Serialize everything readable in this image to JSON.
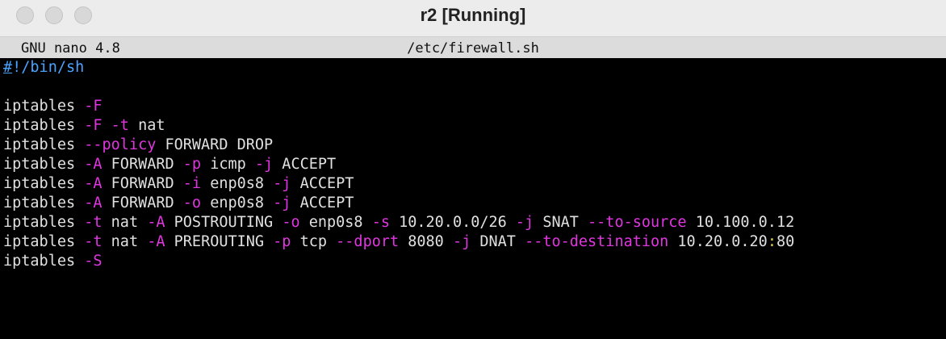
{
  "window": {
    "title": "r2 [Running]"
  },
  "nano": {
    "version": "GNU nano 4.8",
    "filename": "/etc/firewall.sh"
  },
  "file_lines": [
    [
      {
        "t": "#",
        "c": "cursor-hash"
      },
      {
        "t": "!/bin/sh",
        "c": "shebang"
      }
    ],
    [],
    [
      {
        "t": "iptables ",
        "c": "k"
      },
      {
        "t": "-F",
        "c": "o"
      }
    ],
    [
      {
        "t": "iptables ",
        "c": "k"
      },
      {
        "t": "-F",
        "c": "o"
      },
      {
        "t": " ",
        "c": "k"
      },
      {
        "t": "-t",
        "c": "o"
      },
      {
        "t": " nat",
        "c": "k"
      }
    ],
    [
      {
        "t": "iptables ",
        "c": "k"
      },
      {
        "t": "--policy",
        "c": "o"
      },
      {
        "t": " FORWARD DROP",
        "c": "k"
      }
    ],
    [
      {
        "t": "iptables ",
        "c": "k"
      },
      {
        "t": "-A",
        "c": "o"
      },
      {
        "t": " FORWARD ",
        "c": "k"
      },
      {
        "t": "-p",
        "c": "o"
      },
      {
        "t": " icmp ",
        "c": "k"
      },
      {
        "t": "-j",
        "c": "o"
      },
      {
        "t": " ACCEPT",
        "c": "k"
      }
    ],
    [
      {
        "t": "iptables ",
        "c": "k"
      },
      {
        "t": "-A",
        "c": "o"
      },
      {
        "t": " FORWARD ",
        "c": "k"
      },
      {
        "t": "-i",
        "c": "o"
      },
      {
        "t": " enp0s8 ",
        "c": "k"
      },
      {
        "t": "-j",
        "c": "o"
      },
      {
        "t": " ACCEPT",
        "c": "k"
      }
    ],
    [
      {
        "t": "iptables ",
        "c": "k"
      },
      {
        "t": "-A",
        "c": "o"
      },
      {
        "t": " FORWARD ",
        "c": "k"
      },
      {
        "t": "-o",
        "c": "o"
      },
      {
        "t": " enp0s8 ",
        "c": "k"
      },
      {
        "t": "-j",
        "c": "o"
      },
      {
        "t": " ACCEPT",
        "c": "k"
      }
    ],
    [
      {
        "t": "iptables ",
        "c": "k"
      },
      {
        "t": "-t",
        "c": "o"
      },
      {
        "t": " nat ",
        "c": "k"
      },
      {
        "t": "-A",
        "c": "o"
      },
      {
        "t": " POSTROUTING ",
        "c": "k"
      },
      {
        "t": "-o",
        "c": "o"
      },
      {
        "t": " enp0s8 ",
        "c": "k"
      },
      {
        "t": "-s",
        "c": "o"
      },
      {
        "t": " 10.20.0.0/26 ",
        "c": "k"
      },
      {
        "t": "-j",
        "c": "o"
      },
      {
        "t": " SNAT ",
        "c": "k"
      },
      {
        "t": "--to-source",
        "c": "o"
      },
      {
        "t": " 10.100.0.12",
        "c": "k"
      }
    ],
    [
      {
        "t": "iptables ",
        "c": "k"
      },
      {
        "t": "-t",
        "c": "o"
      },
      {
        "t": " nat ",
        "c": "k"
      },
      {
        "t": "-A",
        "c": "o"
      },
      {
        "t": " PREROUTING ",
        "c": "k"
      },
      {
        "t": "-p",
        "c": "o"
      },
      {
        "t": " tcp ",
        "c": "k"
      },
      {
        "t": "--dport",
        "c": "o"
      },
      {
        "t": " 8080 ",
        "c": "k"
      },
      {
        "t": "-j",
        "c": "o"
      },
      {
        "t": " DNAT ",
        "c": "k"
      },
      {
        "t": "--to-destination",
        "c": "o"
      },
      {
        "t": " 10.20.0.20",
        "c": "k"
      },
      {
        "t": ":",
        "c": "colon"
      },
      {
        "t": "80",
        "c": "k"
      }
    ],
    [
      {
        "t": "iptables ",
        "c": "k"
      },
      {
        "t": "-S",
        "c": "o"
      }
    ]
  ],
  "colors": {
    "option": "#e036e0",
    "text": "#e0e0e0",
    "shebang": "#4aa3ff",
    "background": "#000000"
  }
}
